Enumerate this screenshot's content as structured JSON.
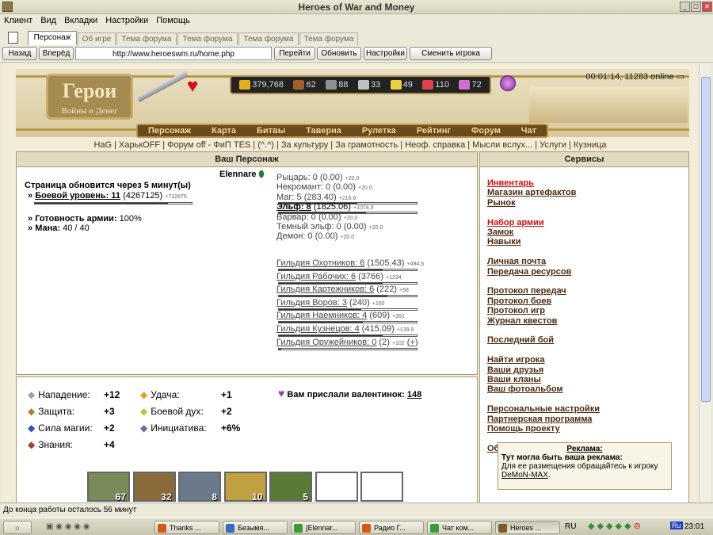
{
  "window": {
    "title": "Heroes of War and Money"
  },
  "menu": [
    "Клиент",
    "Вид",
    "Вкладки",
    "Настройки",
    "Помощь"
  ],
  "tabs": [
    "Персонаж",
    "Об игре",
    "Тема форума",
    "Тема форума",
    "Тема форума",
    "Тема форума"
  ],
  "nav": {
    "back": "Назад",
    "forward": "Вперёд",
    "url": "http://www.heroeswm.ru/home.php",
    "go": "Перейти",
    "refresh": "Обновить",
    "settings": "Настройки",
    "switch_player": "Сменить игрока"
  },
  "header": {
    "logo_title": "Герои",
    "logo_subtitle": "Войны и Денег",
    "clock": "00:01:14, 11283 online",
    "resources": [
      {
        "icon": "gold-icon",
        "value": "379,768",
        "color": "#e0b020"
      },
      {
        "icon": "wood-icon",
        "value": "62",
        "color": "#a0602a"
      },
      {
        "icon": "ore-icon",
        "value": "88",
        "color": "#909090"
      },
      {
        "icon": "mercury-icon",
        "value": "33",
        "color": "#c0c0c0"
      },
      {
        "icon": "sulfur-icon",
        "value": "49",
        "color": "#e8d040"
      },
      {
        "icon": "crystal-icon",
        "value": "110",
        "color": "#e04050"
      },
      {
        "icon": "gems-icon",
        "value": "72",
        "color": "#d070d0"
      }
    ],
    "main_menu": [
      "Персонаж",
      "Карта",
      "Битвы",
      "Таверна",
      "Рулетка",
      "Рейтинг",
      "Форум",
      "Чат"
    ],
    "sub_links": "HaG | ХарькOFF | Форум off - ФиП TES | (^.^) | За культуру | За грамотность | Неоф. справка | Мысли вслух... | Услуги | Кузница"
  },
  "character": {
    "panel_title": "Ваш Персонаж",
    "name": "Elennare",
    "refresh_notice": "Страница обновится через 5 минут(ы)",
    "combat_level_label": "Боевой уровень: 11",
    "combat_level_exp": "(4267125)",
    "combat_level_plus": "+732875",
    "army_ready": "Готовность армии:",
    "army_ready_value": "100%",
    "mana_label": "Мана:",
    "mana_value": "40 / 40",
    "factions": [
      {
        "label": "Рыцарь: 0",
        "value": "(0.00)",
        "plus": "+20.0",
        "bold": false,
        "bar": false,
        "fill": 0
      },
      {
        "label": "Некромант: 0",
        "value": "(0.00)",
        "plus": "+20.0",
        "bold": false,
        "bar": false,
        "fill": 0
      },
      {
        "label": "Маг: 5",
        "value": "(283.40)",
        "plus": "+216.6",
        "bold": false,
        "bar": true,
        "fill": 0.57
      },
      {
        "label": "Эльф: 8",
        "value": "(1825.06)",
        "plus": "+1074.9",
        "bold": true,
        "bar": true,
        "fill": 0.63
      },
      {
        "label": "Варвар: 0",
        "value": "(0.00)",
        "plus": "+20.0",
        "bold": false,
        "bar": false,
        "fill": 0
      },
      {
        "label": "Темный эльф: 0",
        "value": "(0.00)",
        "plus": "+20.0",
        "bold": false,
        "bar": false,
        "fill": 0
      },
      {
        "label": "Демон: 0",
        "value": "(0.00)",
        "plus": "+20.0",
        "bold": false,
        "bar": false,
        "fill": 0
      }
    ],
    "guilds": [
      {
        "label": "Гильдия Охотников: 6",
        "value": "(1505.43)",
        "plus": "+494.6",
        "fill": 0.75
      },
      {
        "label": "Гильдия Рабочих: 6",
        "value": "(3766)",
        "plus": "+1234",
        "fill": 0.75
      },
      {
        "label": "Гильдия Картежников: 6",
        "value": "(222)",
        "plus": "+58",
        "fill": 0.79
      },
      {
        "label": "Гильдия Воров: 3",
        "value": "(240)",
        "plus": "+160",
        "fill": 0.6
      },
      {
        "label": "Гильдия Наемников: 4",
        "value": "(609)",
        "plus": "+391",
        "fill": 0.61
      },
      {
        "label": "Гильдия Кузнецов: 4",
        "value": "(415.09)",
        "plus": "+139.9",
        "fill": 0.75
      },
      {
        "label": "Гильдия Оружейников: 0",
        "value": "(2)",
        "plus": "+102",
        "fill": 0.02
      }
    ],
    "guild_add": "(+)"
  },
  "stats": {
    "left": [
      {
        "icon": "sword-icon",
        "label": "Нападение:",
        "value": "+12",
        "color": "#9aa0a8"
      },
      {
        "icon": "shield-icon",
        "label": "Защита:",
        "value": "+3",
        "color": "#b08030"
      },
      {
        "icon": "wand-icon",
        "label": "Сила магии:",
        "value": "+2",
        "color": "#3050c0"
      },
      {
        "icon": "book-icon",
        "label": "Знания:",
        "value": "+4",
        "color": "#a04030"
      }
    ],
    "right": [
      {
        "icon": "rainbow-icon",
        "label": "Удача:",
        "value": "+1",
        "color": "#e0a020"
      },
      {
        "icon": "wings-icon",
        "label": "Боевой дух:",
        "value": "+2",
        "color": "#c0c040"
      },
      {
        "icon": "potion-icon",
        "label": "Инициатива:",
        "value": "+6%",
        "color": "#8060a0"
      }
    ],
    "valentine_label": "Вам прислали валентинок:",
    "valentine_count": "148",
    "army_counts": [
      "67",
      "32",
      "8",
      "10",
      "5"
    ]
  },
  "services": {
    "title": "Сервисы",
    "groups": [
      [
        {
          "label": "Инвентарь",
          "red": true
        },
        {
          "label": "Магазин артефактов"
        },
        {
          "label": "Рынок"
        }
      ],
      [
        {
          "label": "Набор армии",
          "red": true
        },
        {
          "label": "Замок"
        },
        {
          "label": "Навыки"
        }
      ],
      [
        {
          "label": "Личная почта"
        },
        {
          "label": "Передача ресурсов"
        }
      ],
      [
        {
          "label": "Протокол передач"
        },
        {
          "label": "Протокол боев"
        },
        {
          "label": "Протокол игр"
        },
        {
          "label": "Журнал квестов"
        }
      ],
      [
        {
          "label": "Последний бой"
        }
      ],
      [
        {
          "label": "Найти игрока"
        },
        {
          "label": "Ваши друзья"
        },
        {
          "label": "Ваши кланы"
        },
        {
          "label": "Ваш фотоальбом"
        }
      ],
      [
        {
          "label": "Персональные настройки"
        },
        {
          "label": "Партнерская программа"
        },
        {
          "label": "Помощь проекту"
        }
      ],
      [
        {
          "label": "Об игре"
        }
      ]
    ],
    "ad_title": "Реклама:",
    "ad_headline": "Тут могла быть ваша реклама:",
    "ad_text": "Для ее размещения обращайтесь к игроку",
    "ad_player": "DeMoN-MAX",
    "ad_end": "."
  },
  "status": "До конца работы осталось 56 минут",
  "taskbar": {
    "items": [
      "Thanks ...",
      "Безымя...",
      "[Elennar...",
      "Радио Г...",
      "Чат ком...",
      "Heroes ..."
    ],
    "lang": "RU",
    "time": "23:01",
    "tray_lang": "Ru"
  }
}
